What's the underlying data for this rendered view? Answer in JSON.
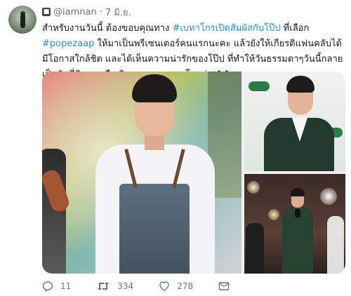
{
  "tweet": {
    "handle": "@iamnan",
    "separator": "·",
    "date": "7 มิ.ย.",
    "text": {
      "part1": "สำหรับงานวันนี้ ต้องขอบคุณทาง ",
      "hashtag1": "#เบทาโกรเปิดสัมผัสกับโป๊ป",
      "part2": " ที่เลือก ",
      "hashtag2": "#popezaap",
      "part3": " ให้มาเป็นพรีเซนเตอร์คนแรกนะคะ แล้วยังให้เกียรติแฟนคลับได้มีโอกาสใกล้ชิด และได้เห็นความน่ารักของโป๊ป ที่ทำให้วันธรรมดาๆวันนี้กลายเป็นวันที่พิเศษเหลือเกิน ขอบคุณเบทาโกรค่า ^^"
    },
    "actions": {
      "reply_count": "11",
      "retweet_count": "334",
      "like_count": "278"
    }
  },
  "icons": {
    "verified": "badge-icon",
    "reply": "reply-icon",
    "retweet": "retweet-icon",
    "like": "heart-icon",
    "message": "envelope-icon"
  },
  "colors": {
    "link": "#1b95e0",
    "muted": "#657786",
    "text": "#14171a"
  }
}
